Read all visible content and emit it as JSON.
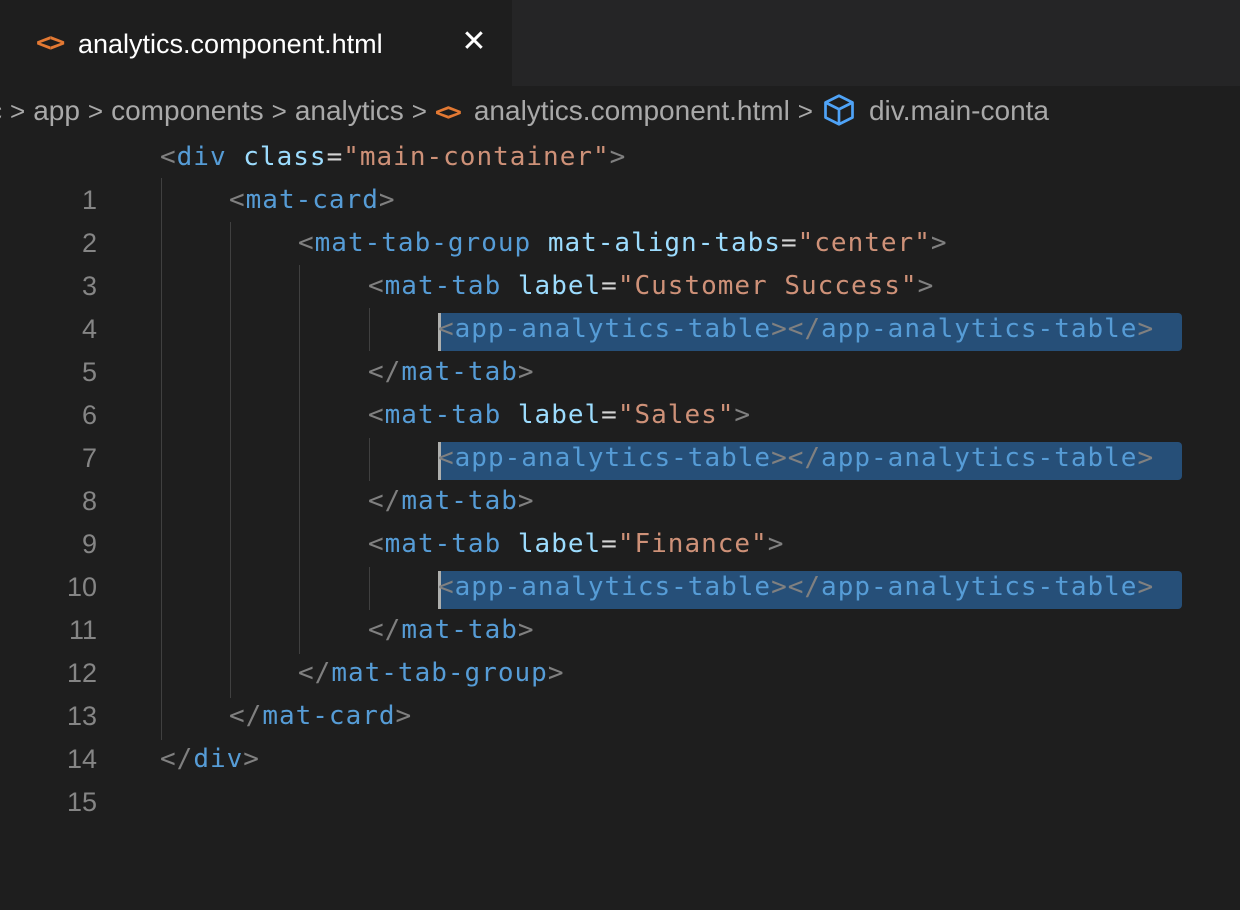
{
  "tab": {
    "icon": "html-file-icon",
    "icon_glyph": "<>",
    "title": "analytics.component.html",
    "close_glyph": "✕"
  },
  "breadcrumb": {
    "items": [
      "c",
      "app",
      "components",
      "analytics",
      "analytics.component.html",
      "div.main-conta"
    ],
    "separator": ">",
    "file_icon_glyph": "<>",
    "symbol_icon": "cube-icon"
  },
  "editor": {
    "line_numbers": [
      "1",
      "2",
      "3",
      "4",
      "5",
      "6",
      "7",
      "8",
      "9",
      "10",
      "11",
      "12",
      "13",
      "14",
      "15"
    ],
    "lines": [
      {
        "open": "<",
        "tag": "div",
        "attr": "class",
        "eq": "=",
        "value": "\"main-container\"",
        "close": ">"
      },
      {
        "open": "<",
        "tag": "mat-card",
        "close": ">"
      },
      {
        "open": "<",
        "tag": "mat-tab-group",
        "attr": "mat-align-tabs",
        "eq": "=",
        "value": "\"center\"",
        "close": ">"
      },
      {
        "open": "<",
        "tag": "mat-tab",
        "attr": "label",
        "eq": "=",
        "value": "\"Customer Success\"",
        "close": ">"
      },
      {
        "open": "<",
        "tag": "app-analytics-table",
        "mid": "></",
        "tag2": "app-analytics-table",
        "close": ">"
      },
      {
        "open": "</",
        "tag": "mat-tab",
        "close": ">"
      },
      {
        "open": "<",
        "tag": "mat-tab",
        "attr": "label",
        "eq": "=",
        "value": "\"Sales\"",
        "close": ">"
      },
      {
        "open": "<",
        "tag": "app-analytics-table",
        "mid": "></",
        "tag2": "app-analytics-table",
        "close": ">"
      },
      {
        "open": "</",
        "tag": "mat-tab",
        "close": ">"
      },
      {
        "open": "<",
        "tag": "mat-tab",
        "attr": "label",
        "eq": "=",
        "value": "\"Finance\"",
        "close": ">"
      },
      {
        "open": "<",
        "tag": "app-analytics-table",
        "mid": "></",
        "tag2": "app-analytics-table",
        "close": ">"
      },
      {
        "open": "</",
        "tag": "mat-tab",
        "close": ">"
      },
      {
        "open": "</",
        "tag": "mat-tab-group",
        "close": ">"
      },
      {
        "open": "</",
        "tag": "mat-card",
        "close": ">"
      },
      {
        "open": "</",
        "tag": "div",
        "close": ">"
      }
    ]
  },
  "colors": {
    "background": "#1e1e1e",
    "tabbar": "#252526",
    "tag": "#569cd6",
    "attribute": "#9cdcfe",
    "string": "#ce9178",
    "punctuation": "#808080",
    "selection": "#264f78",
    "html_icon": "#e37933"
  }
}
